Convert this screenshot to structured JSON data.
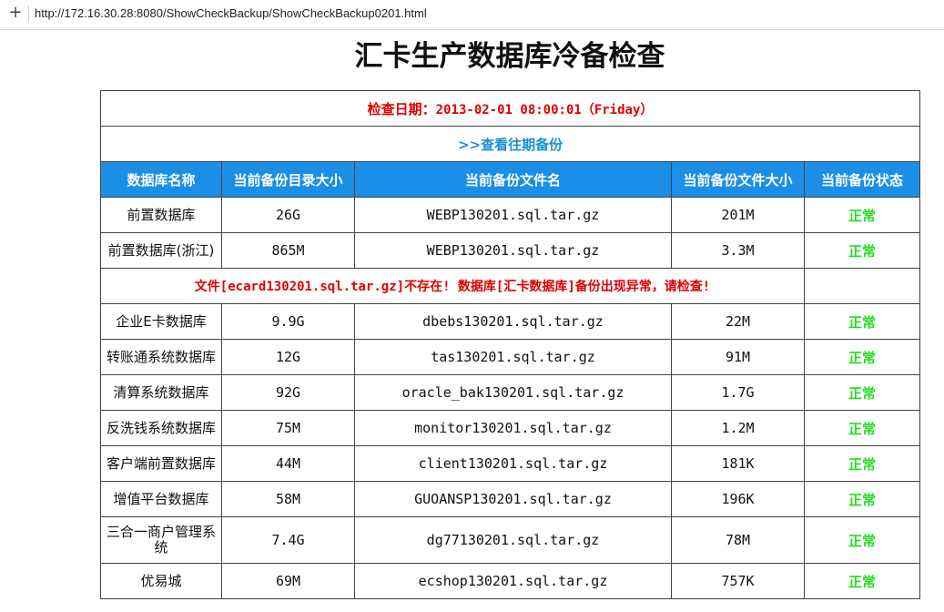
{
  "browser": {
    "url": "http://172.16.30.28:8080/ShowCheckBackup/ShowCheckBackup0201.html",
    "new_tab_icon": "plus-icon"
  },
  "page": {
    "title": "汇卡生产数据库冷备检查",
    "check_date_label": "检查日期：",
    "check_date_value": "2013-02-01 08:00:01（Friday）",
    "history_link": ">>查看往期备份"
  },
  "table": {
    "headers": [
      "数据库名称",
      "当前备份目录大小",
      "当前备份文件名",
      "当前备份文件大小",
      "当前备份状态"
    ],
    "rows_before_error": [
      {
        "name": "前置数据库",
        "dir_size": "26G",
        "file": "WEBP130201.sql.tar.gz",
        "file_size": "201M",
        "status": "正常"
      },
      {
        "name": "前置数据库(浙江)",
        "dir_size": "865M",
        "file": "WEBP130201.sql.tar.gz",
        "file_size": "3.3M",
        "status": "正常"
      }
    ],
    "error_message": "文件[ecard130201.sql.tar.gz]不存在! 数据库[汇卡数据库]备份出现异常，请检查!",
    "rows_after_error": [
      {
        "name": "企业E卡数据库",
        "dir_size": "9.9G",
        "file": "dbebs130201.sql.tar.gz",
        "file_size": "22M",
        "status": "正常"
      },
      {
        "name": "转账通系统数据库",
        "dir_size": "12G",
        "file": "tas130201.sql.tar.gz",
        "file_size": "91M",
        "status": "正常"
      },
      {
        "name": "清算系统数据库",
        "dir_size": "92G",
        "file": "oracle_bak130201.sql.tar.gz",
        "file_size": "1.7G",
        "status": "正常"
      },
      {
        "name": "反洗钱系统数据库",
        "dir_size": "75M",
        "file": "monitor130201.sql.tar.gz",
        "file_size": "1.2M",
        "status": "正常"
      },
      {
        "name": "客户端前置数据库",
        "dir_size": "44M",
        "file": "client130201.sql.tar.gz",
        "file_size": "181K",
        "status": "正常"
      },
      {
        "name": "增值平台数据库",
        "dir_size": "58M",
        "file": "GUOANSP130201.sql.tar.gz",
        "file_size": "196K",
        "status": "正常"
      },
      {
        "name": "三合一商户管理系统",
        "dir_size": "7.4G",
        "file": "dg77130201.sql.tar.gz",
        "file_size": "78M",
        "status": "正常"
      },
      {
        "name": "优易城",
        "dir_size": "69M",
        "file": "ecshop130201.sql.tar.gz",
        "file_size": "757K",
        "status": "正常"
      }
    ]
  },
  "colors": {
    "header_bg": "#1b8fe8",
    "ok": "#22dd22",
    "error": "#e00000",
    "link": "#1a8fd8"
  }
}
